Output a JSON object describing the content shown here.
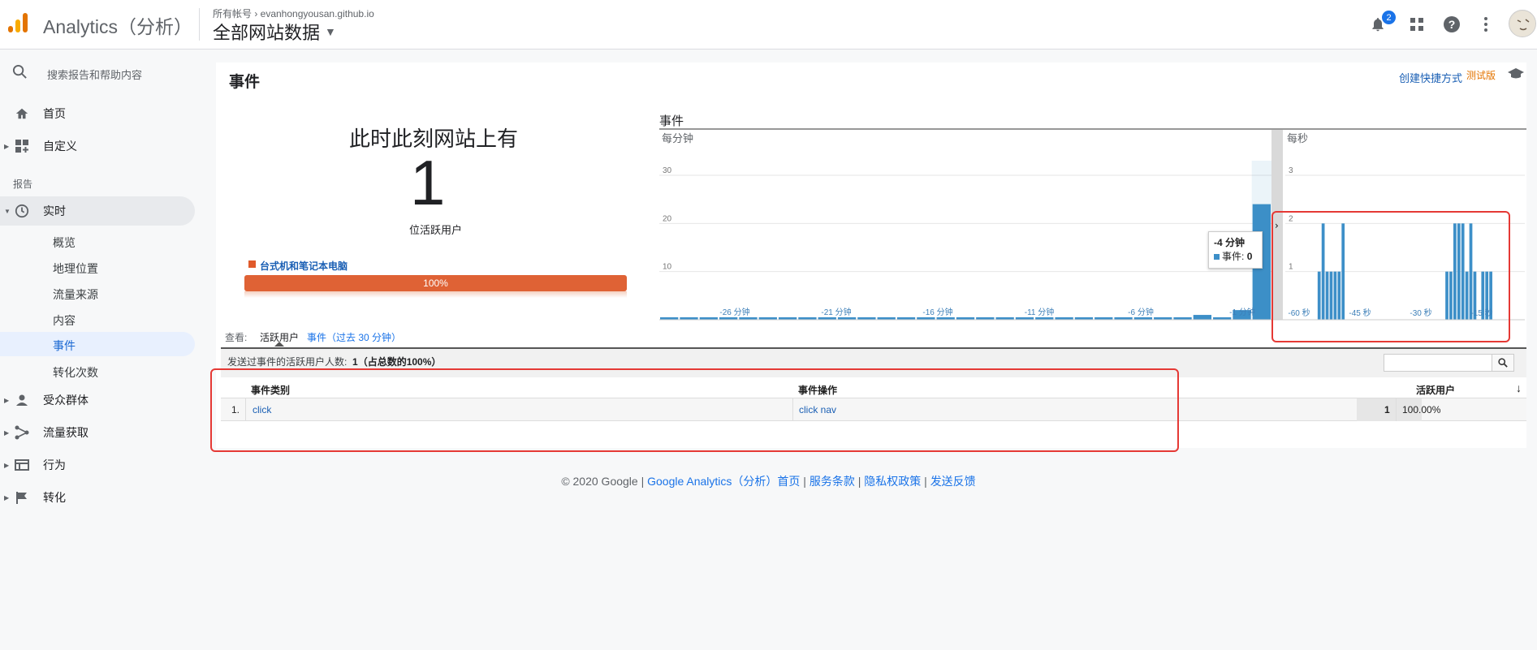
{
  "header": {
    "app_title": "Analytics（分析）",
    "account_path": "所有帐号 › evanhongyousan.github.io",
    "view_name": "全部网站数据",
    "notification_count": "2"
  },
  "sidebar": {
    "search_placeholder": "搜索报告和帮助内容",
    "home": "首页",
    "customize": "自定义",
    "section_reports": "报告",
    "realtime": "实时",
    "realtime_items": [
      "概览",
      "地理位置",
      "流量来源",
      "内容",
      "事件",
      "转化次数"
    ],
    "audience": "受众群体",
    "acquisition": "流量获取",
    "behavior": "行为",
    "conversions": "转化"
  },
  "page": {
    "title": "事件",
    "shortcut": "创建快捷方式",
    "beta": "测试版",
    "headline": "此时此刻网站上有",
    "active_count": "1",
    "active_label": "位活跃用户",
    "device_label": "台式机和笔记本电脑",
    "device_percent": "100%"
  },
  "chart_data": {
    "type": "bar",
    "title": "事件",
    "per_minute": {
      "label": "每分钟",
      "yticks": [
        "10",
        "20",
        "30"
      ],
      "ylim": [
        0,
        30
      ],
      "xticks": [
        "-26 分钟",
        "-21 分钟",
        "-16 分钟",
        "-11 分钟",
        "-6 分钟",
        "-1 分钟"
      ],
      "values": [
        0,
        0,
        0,
        0,
        0,
        0,
        0,
        0,
        0,
        0,
        0,
        0,
        0,
        0,
        0,
        0,
        0,
        0,
        0,
        0,
        0,
        0,
        0,
        0,
        0,
        0,
        0,
        1,
        0,
        2,
        24
      ]
    },
    "per_second": {
      "label": "每秒",
      "yticks": [
        "1",
        "2",
        "3"
      ],
      "ylim": [
        0,
        3
      ],
      "xticks": [
        "-60 秒",
        "-45 秒",
        "-30 秒",
        "-15 秒"
      ],
      "values": [
        0,
        0,
        0,
        0,
        0,
        0,
        0,
        0,
        1,
        2,
        1,
        1,
        1,
        1,
        2,
        0,
        0,
        0,
        0,
        0,
        0,
        0,
        0,
        0,
        0,
        0,
        0,
        0,
        0,
        0,
        0,
        0,
        0,
        0,
        0,
        0,
        0,
        0,
        0,
        0,
        1,
        1,
        2,
        2,
        2,
        1,
        2,
        1,
        0,
        1,
        1,
        1,
        0,
        0,
        0,
        0,
        0,
        0,
        0,
        0
      ]
    },
    "tooltip": {
      "time": "-4 分钟",
      "series": "事件",
      "value": "0"
    }
  },
  "table": {
    "view_label": "查看:",
    "view_active": "活跃用户",
    "view_events": "事件（过去 30 分钟）",
    "summary_prefix": "发送过事件的活跃用户人数:",
    "summary_value": "1（占总数的100%）",
    "headers": [
      "事件类别",
      "事件操作",
      "活跃用户"
    ],
    "rows": [
      {
        "index": "1.",
        "category": "click",
        "action": "click nav",
        "users": "1",
        "percent": "100.00%"
      }
    ]
  },
  "footer": {
    "copyright": "© 2020 Google |",
    "links": [
      "Google Analytics（分析）首页",
      "服务条款",
      "隐私权政策",
      "发送反馈"
    ]
  }
}
